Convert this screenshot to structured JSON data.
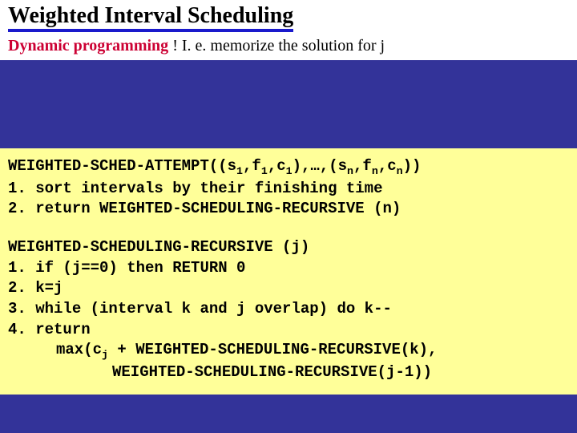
{
  "header": {
    "title": "Weighted Interval Scheduling",
    "sub_hl": "Dynamic programming",
    "sub_rest": " !  I. e. memorize the solution for j"
  },
  "code1": {
    "l0a": "WEIGHTED-SCHED-ATTEMPT((s",
    "l0s1": "1",
    "l0b": ",f",
    "l0s2": "1",
    "l0c": ",c",
    "l0s3": "1",
    "l0d": "),…,(s",
    "l0s4": "n",
    "l0e": ",f",
    "l0s5": "n",
    "l0f": ",c",
    "l0s6": "n",
    "l0g": "))",
    "l1": "1. sort intervals by their finishing time",
    "l2": "2. return WEIGHTED-SCHEDULING-RECURSIVE (n)"
  },
  "code2": {
    "l0": "WEIGHTED-SCHEDULING-RECURSIVE (j)",
    "l1": "1. if (j==0) then RETURN 0",
    "l2": "2. k=j",
    "l3": "3. while (interval k and j overlap) do k--",
    "l4": "4. return",
    "l5a": "max(c",
    "l5s": "j",
    "l5b": " + WEIGHTED-SCHEDULING-RECURSIVE(k),",
    "l6": "WEIGHTED-SCHEDULING-RECURSIVE(j-1))"
  }
}
